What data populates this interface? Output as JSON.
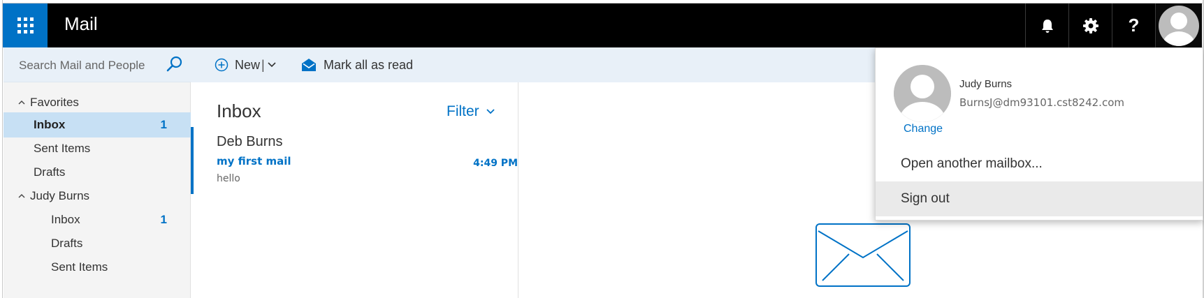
{
  "app": {
    "title": "Mail"
  },
  "topbar": {
    "launcher_icon": "waffle-grid-icon",
    "notification_icon": "bell-icon",
    "settings_icon": "gear-icon",
    "help_label": "?",
    "account_icon": "user-avatar-icon"
  },
  "search": {
    "placeholder": "Search Mail and People",
    "icon": "search-icon"
  },
  "commands": {
    "new_label": "New",
    "new_separator": "|",
    "mark_all_read_label": "Mark all as read"
  },
  "nav": {
    "favorites": {
      "label": "Favorites",
      "items": [
        {
          "label": "Inbox",
          "count": "1",
          "active": true
        },
        {
          "label": "Sent Items",
          "count": ""
        },
        {
          "label": "Drafts",
          "count": ""
        }
      ]
    },
    "account": {
      "label": "Judy Burns",
      "items": [
        {
          "label": "Inbox",
          "count": "1"
        },
        {
          "label": "Drafts",
          "count": ""
        },
        {
          "label": "Sent Items",
          "count": ""
        }
      ]
    }
  },
  "message_list": {
    "title": "Inbox",
    "filter_label": "Filter",
    "messages": [
      {
        "sender": "Deb Burns",
        "subject": "my first mail",
        "time": "4:49 PM",
        "preview": "hello"
      }
    ]
  },
  "account_menu": {
    "name": "Judy Burns",
    "email": "BurnsJ@dm93101.cst8242.com",
    "change_label": "Change",
    "open_mailbox_label": "Open another mailbox...",
    "sign_out_label": "Sign out"
  },
  "colors": {
    "accent": "#0072c6",
    "topbar": "#000000",
    "nav_bg": "#f4f4f4",
    "selected_bg": "#c7e0f4",
    "cmdbar_bg": "#e8f0f8"
  }
}
